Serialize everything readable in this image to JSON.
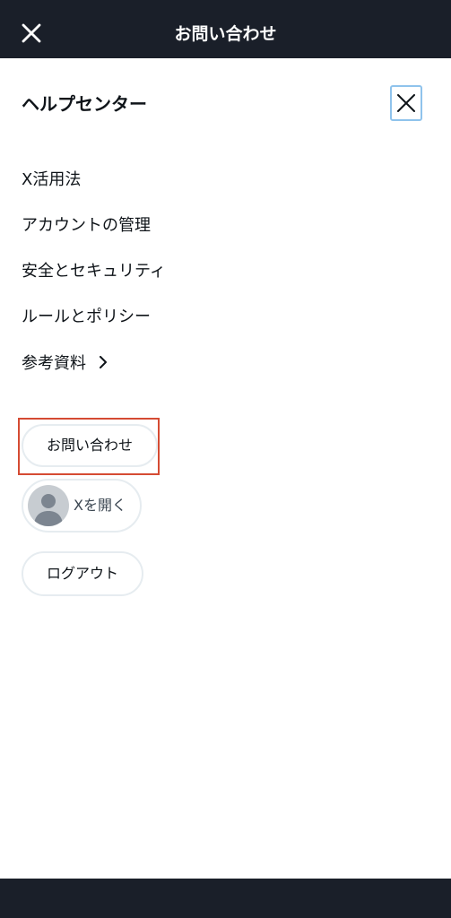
{
  "header": {
    "title": "お問い合わせ"
  },
  "menu": {
    "title": "ヘルプセンター",
    "items": [
      {
        "label": "X活用法"
      },
      {
        "label": "アカウントの管理"
      },
      {
        "label": "安全とセキュリティ"
      },
      {
        "label": "ルールとポリシー"
      },
      {
        "label": "参考資料"
      }
    ]
  },
  "buttons": {
    "contact": "お問い合わせ",
    "open_x": "Xを開く",
    "logout": "ログアウト"
  },
  "colors": {
    "header_bg": "#1a1f29",
    "highlight": "#d54b33",
    "focus_ring": "#8fc3ec",
    "avatar_bg": "#c7ccd1",
    "pill_border": "#e6ecf0"
  }
}
